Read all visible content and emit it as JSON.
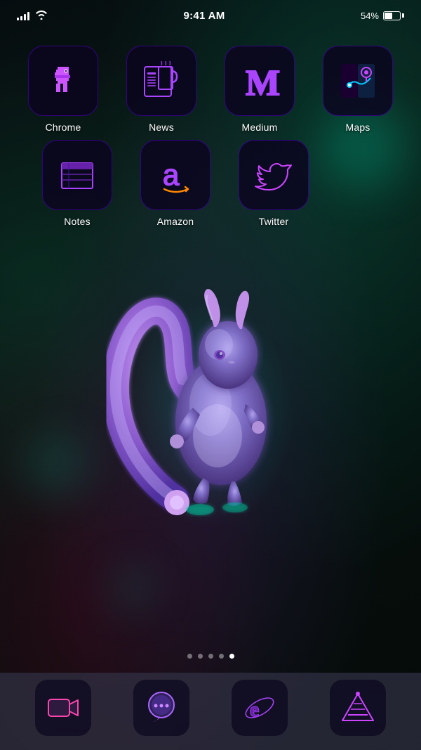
{
  "statusBar": {
    "time": "9:41 AM",
    "battery": "54%",
    "batteryFill": 54
  },
  "apps": {
    "row1": [
      {
        "id": "chrome",
        "label": "Chrome"
      },
      {
        "id": "news",
        "label": "News"
      },
      {
        "id": "medium",
        "label": "Medium"
      },
      {
        "id": "maps",
        "label": "Maps"
      }
    ],
    "row2": [
      {
        "id": "notes",
        "label": "Notes"
      },
      {
        "id": "amazon",
        "label": "Amazon"
      },
      {
        "id": "twitter",
        "label": "Twitter"
      }
    ]
  },
  "dock": [
    {
      "id": "facetime",
      "label": ""
    },
    {
      "id": "messages",
      "label": ""
    },
    {
      "id": "explorer",
      "label": ""
    },
    {
      "id": "vlc",
      "label": ""
    }
  ],
  "pageDots": {
    "total": 5,
    "active": 4
  }
}
